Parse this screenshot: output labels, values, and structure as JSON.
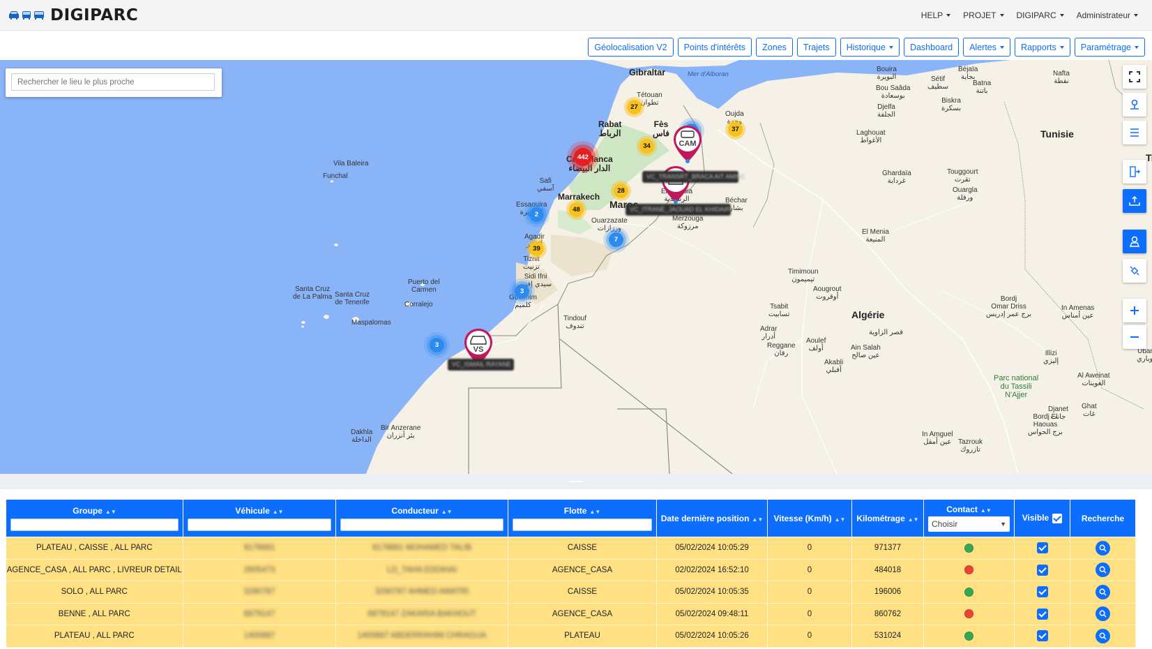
{
  "app": {
    "name": "DIGIPARC"
  },
  "topnav": [
    {
      "label": "HELP"
    },
    {
      "label": "PROJET"
    },
    {
      "label": "DIGIPARC"
    },
    {
      "label": "Administrateur"
    }
  ],
  "toolbar": [
    {
      "label": "Géolocalisation V2",
      "dropdown": false
    },
    {
      "label": "Points d'intérêts",
      "dropdown": false
    },
    {
      "label": "Zones",
      "dropdown": false
    },
    {
      "label": "Trajets",
      "dropdown": false
    },
    {
      "label": "Historique",
      "dropdown": true
    },
    {
      "label": "Dashboard",
      "dropdown": false
    },
    {
      "label": "Alertes",
      "dropdown": true
    },
    {
      "label": "Rapports",
      "dropdown": true
    },
    {
      "label": "Paramétrage",
      "dropdown": true
    }
  ],
  "map": {
    "search_placeholder": "Rechercher le lieu le plus proche",
    "labels": {
      "gibraltar": "Gibraltar",
      "alboran": "Mer d'Alboran",
      "tetouan": "Tétouan\nتطوان",
      "rabat": "Rabat\nالرباط",
      "fes": "Fès\nفاس",
      "oujda": "Oujda\nوجدة",
      "casablanca": "Casablanca\nالدار البيضاء",
      "safi": "Safi\nآسفي",
      "marrakech": "Marrakech",
      "maroc": "Maroc",
      "essaouira": "Essaouira\nالصويرة",
      "agadir": "Agadir\nأكادير",
      "tiznit": "Tiznit\nتزنيت",
      "sidiifni": "Sidi Ifni\nسيدي إفني",
      "guelmim": "Guelmim\nكلميم",
      "ouarzazate": "Ouarzazate\nورزازات",
      "errachidia": "Errachidia\nالرشيدية",
      "merzouga": "Merzouga\nمرزوكة",
      "bechar": "Béchar\nبشار",
      "vilabaleira": "Vila Baleira",
      "funchal": "Funchal",
      "santacruzpalma": "Santa Cruz\nde La Palma",
      "santacruztenerife": "Santa Cruz\nde Tenerife",
      "puertocarmen": "Puerto del\nCarmen",
      "corralejo": "Corralejo",
      "maspalomas": "Maspalomas",
      "tindouf": "Tindouf\nتندوف",
      "dakhla": "Dakhla\nالداخلة",
      "biranzerane": "Bir Anzerane\nبئر أنزران",
      "algerie": "Algérie",
      "tunisie": "Tunisie",
      "bejaia": "Béjaïa\nبجاية",
      "setif": "Sétif\nسطيف",
      "djelfa": "Djelfa\nالجلفة",
      "bousaada": "Bou Saâda\nبوسعادة",
      "batna": "Batna\nباتنة",
      "biskra": "Biskra\nبسكرة",
      "laghouat": "Laghouat\nالأغواط",
      "ghardaia": "Ghardaïa\nغرداية",
      "touggourt": "Touggourt\nتقرت",
      "ouargla": "Ouargla\nورقلة",
      "elmenia": "El Menia\nالمنيعة",
      "timimoun": "Timimoun\nتيميمون",
      "aougrout": "Aougrout\nأوقروت",
      "tsabit": "Tsabit\nتسابيت",
      "adrar": "Adrar\nأدرار",
      "aoulef": "Aoulef\nأولف",
      "insalah": "Ain Salah\nعين صالح",
      "reggane": "Reggane\nرقان",
      "akabli": "Akabli\nأقبلي",
      "kseferaouia": "قصر الزاوية",
      "bordjomar": "Bordj\nOmar Driss\nبرج عمر إدريس",
      "inamenas": "In Amenas\nعين أمناس",
      "illizi": "Illizi\nإليزي",
      "tassili": "Parc national\ndu Tassili\nN'Ajjer",
      "djanet": "Djanet\nجانت",
      "bordjelhaouas": "Bordj El\nHaouas\nبرج الحواس",
      "ghat": "Ghat\nغات",
      "alweinat": "Al Aweinat\nالعوينات",
      "inamguel": "In Amguel\nعين أمقل",
      "tazrouk": "Tazrouk\nتازروك",
      "bouira": "Bouira\nالبويرة",
      "nafta": "Nafta\nنفطة",
      "ubari": "Ubari\nأوباري",
      "tr": "Tr"
    },
    "clusters": [
      {
        "id": "c27",
        "count": "27",
        "color": "orange"
      },
      {
        "id": "c442",
        "count": "442",
        "color": "red"
      },
      {
        "id": "c34",
        "count": "34",
        "color": "orange"
      },
      {
        "id": "c7a",
        "count": "7",
        "color": "blue"
      },
      {
        "id": "c37",
        "count": "37",
        "color": "orange"
      },
      {
        "id": "c28",
        "count": "28",
        "color": "orange"
      },
      {
        "id": "c48",
        "count": "48",
        "color": "orange"
      },
      {
        "id": "c2",
        "count": "2",
        "color": "blue"
      },
      {
        "id": "c39",
        "count": "39",
        "color": "orange"
      },
      {
        "id": "c7b",
        "count": "7",
        "color": "blue"
      },
      {
        "id": "c3a",
        "count": "3",
        "color": "blue"
      },
      {
        "id": "c3b",
        "count": "3",
        "color": "blue"
      }
    ],
    "pins": [
      {
        "id": "cam",
        "label": "CAM"
      },
      {
        "id": "vs",
        "label": "VS"
      }
    ],
    "vehicle_tags": [
      {
        "id": "t1",
        "text": "VC_TRANSRT_BRACA AIT AMINE"
      },
      {
        "id": "t2",
        "text": "VC_ITRANE_JAOUAD EL KHIDAIR"
      },
      {
        "id": "t3",
        "text": "VC_ISMAIL RAYANE"
      }
    ]
  },
  "table": {
    "headers": {
      "groupe": "Groupe",
      "vehicule": "Véhicule",
      "conducteur": "Conducteur",
      "flotte": "Flotte",
      "date": "Date dernière position",
      "vitesse": "Vitesse (Km/h)",
      "km": "Kilométrage",
      "contact": "Contact",
      "contact_select": "Choisir",
      "visible": "Visible",
      "recherche": "Recherche"
    },
    "rows": [
      {
        "groupe": "PLATEAU , CAISSE , ALL PARC",
        "vehicule": "9178681",
        "conducteur": "9178681 MOHAMED TALIB",
        "flotte": "CAISSE",
        "date": "05/02/2024 10:05:29",
        "vitesse": "0",
        "km": "971377",
        "contact_color": "#34a853"
      },
      {
        "groupe": "AGENCE_CASA , ALL PARC , LIVREUR DETAIL",
        "vehicule": "2605473",
        "conducteur": "LD_TAHA EDDIHAI",
        "flotte": "AGENCE_CASA",
        "date": "02/02/2024 16:52:10",
        "vitesse": "0",
        "km": "484018",
        "contact_color": "#ea4335"
      },
      {
        "groupe": "SOLO , ALL PARC",
        "vehicule": "3290787",
        "conducteur": "3290787 AHMED AWATRI",
        "flotte": "CAISSE",
        "date": "05/02/2024 10:05:35",
        "vitesse": "0",
        "km": "196006",
        "contact_color": "#34a853"
      },
      {
        "groupe": "BENNE , ALL PARC",
        "vehicule": "6879147",
        "conducteur": "6879147 ZAKARIA BAKHOUT",
        "flotte": "AGENCE_CASA",
        "date": "05/02/2024 09:48:11",
        "vitesse": "0",
        "km": "860762",
        "contact_color": "#ea4335"
      },
      {
        "groupe": "PLATEAU , ALL PARC",
        "vehicule": "1400887",
        "conducteur": "1400887 ABDERRAHIM CHRAGUA",
        "flotte": "PLATEAU",
        "date": "05/02/2024 10:05:26",
        "vitesse": "0",
        "km": "531024",
        "contact_color": "#34a853"
      }
    ]
  }
}
